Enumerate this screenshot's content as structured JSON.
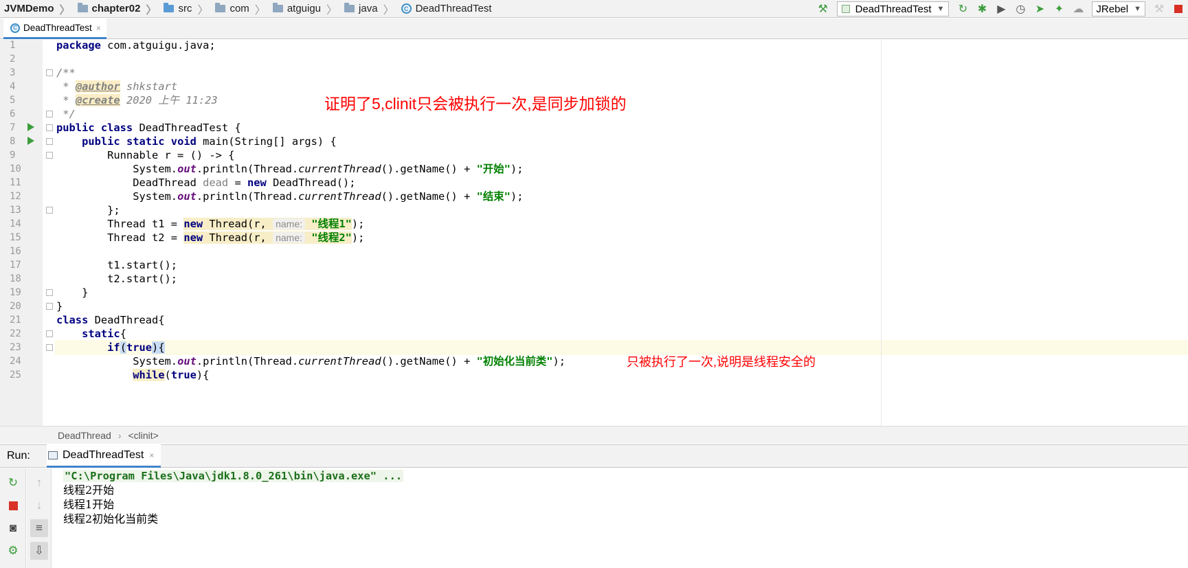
{
  "breadcrumbs": [
    "JVMDemo",
    "chapter02",
    "src",
    "com",
    "atguigu",
    "java",
    "DeadThreadTest"
  ],
  "toolbar": {
    "run_config": "DeadThreadTest",
    "jrebel": "JRebel",
    "icons": [
      "build-hammer-icon",
      "rerun-icon",
      "debug-icon",
      "coverage-icon",
      "profile-icon",
      "jrebel-run-icon",
      "jrebel-debug-icon",
      "attach-icon",
      "stop-icon"
    ]
  },
  "editor_tab": {
    "label": "DeadThreadTest",
    "close": "×"
  },
  "gutter": {
    "line_numbers": [
      "1",
      "2",
      "3",
      "4",
      "5",
      "6",
      "7",
      "8",
      "9",
      "10",
      "11",
      "12",
      "13",
      "14",
      "15",
      "16",
      "17",
      "18",
      "19",
      "20",
      "21",
      "22",
      "23",
      "24",
      "25"
    ]
  },
  "code": {
    "l1": {
      "kw": "package",
      "rest": " com.atguigu.java;"
    },
    "l3": "/**",
    "l4": {
      "star": " * ",
      "tag": "@author",
      "rest": " shkstart"
    },
    "l5": {
      "star": " * ",
      "tag": "@create",
      "rest": " 2020 上午 11:23"
    },
    "l6": " */",
    "l7": {
      "kw": "public class",
      "rest": " DeadThreadTest {"
    },
    "l8": {
      "indent": "    ",
      "kw": "public static void",
      "rest": " main(String[] args) {"
    },
    "l9": "        Runnable r = () -> {",
    "l10": {
      "a": "            System.",
      "fld": "out",
      "b": ".println(Thread.",
      "it": "currentThread",
      "c": "().getName() + ",
      "str": "\"开始\"",
      "d": ");"
    },
    "l11": {
      "a": "            DeadThread ",
      "unused": "dead",
      "b": " = ",
      "kw": "new",
      "c": " DeadThread();"
    },
    "l12": {
      "a": "            System.",
      "fld": "out",
      "b": ".println(Thread.",
      "it": "currentThread",
      "c": "().getName() + ",
      "str": "\"结束\"",
      "d": ");"
    },
    "l13": "        };",
    "l14": {
      "a": "        Thread t1 = ",
      "kw": "new",
      "b": " Thread(r, ",
      "hint": "name:",
      "str": "\"线程1\"",
      "c": ");"
    },
    "l15": {
      "a": "        Thread t2 = ",
      "kw": "new",
      "b": " Thread(r, ",
      "hint": "name:",
      "str": "\"线程2\"",
      "c": ");"
    },
    "l17": "        t1.start();",
    "l18": "        t2.start();",
    "l19": "    }",
    "l20": "}",
    "l21": {
      "kw": "class",
      "rest": " DeadThread{"
    },
    "l22": {
      "indent": "    ",
      "kw": "static",
      "rest": "{"
    },
    "l23": {
      "indent": "        ",
      "kw1": "if",
      "p1": "(",
      "kw2": "true",
      "p2": "){"
    },
    "l24": {
      "a": "            System.",
      "fld": "out",
      "b": ".println(Thread.",
      "it": "currentThread",
      "c": "().getName() + ",
      "str": "\"初始化当前类\"",
      "d": ");"
    },
    "l25": {
      "indent": "            ",
      "kw1": "while",
      "p1": "(",
      "kw2": "true",
      "p2": "){"
    }
  },
  "annotations": {
    "top": "证明了5,clinit只会被执行一次,是同步加锁的",
    "inline": "只被执行了一次,说明是线程安全的"
  },
  "editor_breadcrumb": [
    "DeadThread",
    "<clinit>"
  ],
  "run_panel": {
    "label": "Run:",
    "tab": "DeadThreadTest",
    "console": [
      "\"C:\\Program Files\\Java\\jdk1.8.0_261\\bin\\java.exe\" ...",
      "线程2开始",
      "线程1开始",
      "线程2初始化当前类"
    ]
  },
  "colors": {
    "keyword": "#000080",
    "string": "#008000",
    "annotation": "#ff0000",
    "tab_accent": "#4083c9"
  }
}
